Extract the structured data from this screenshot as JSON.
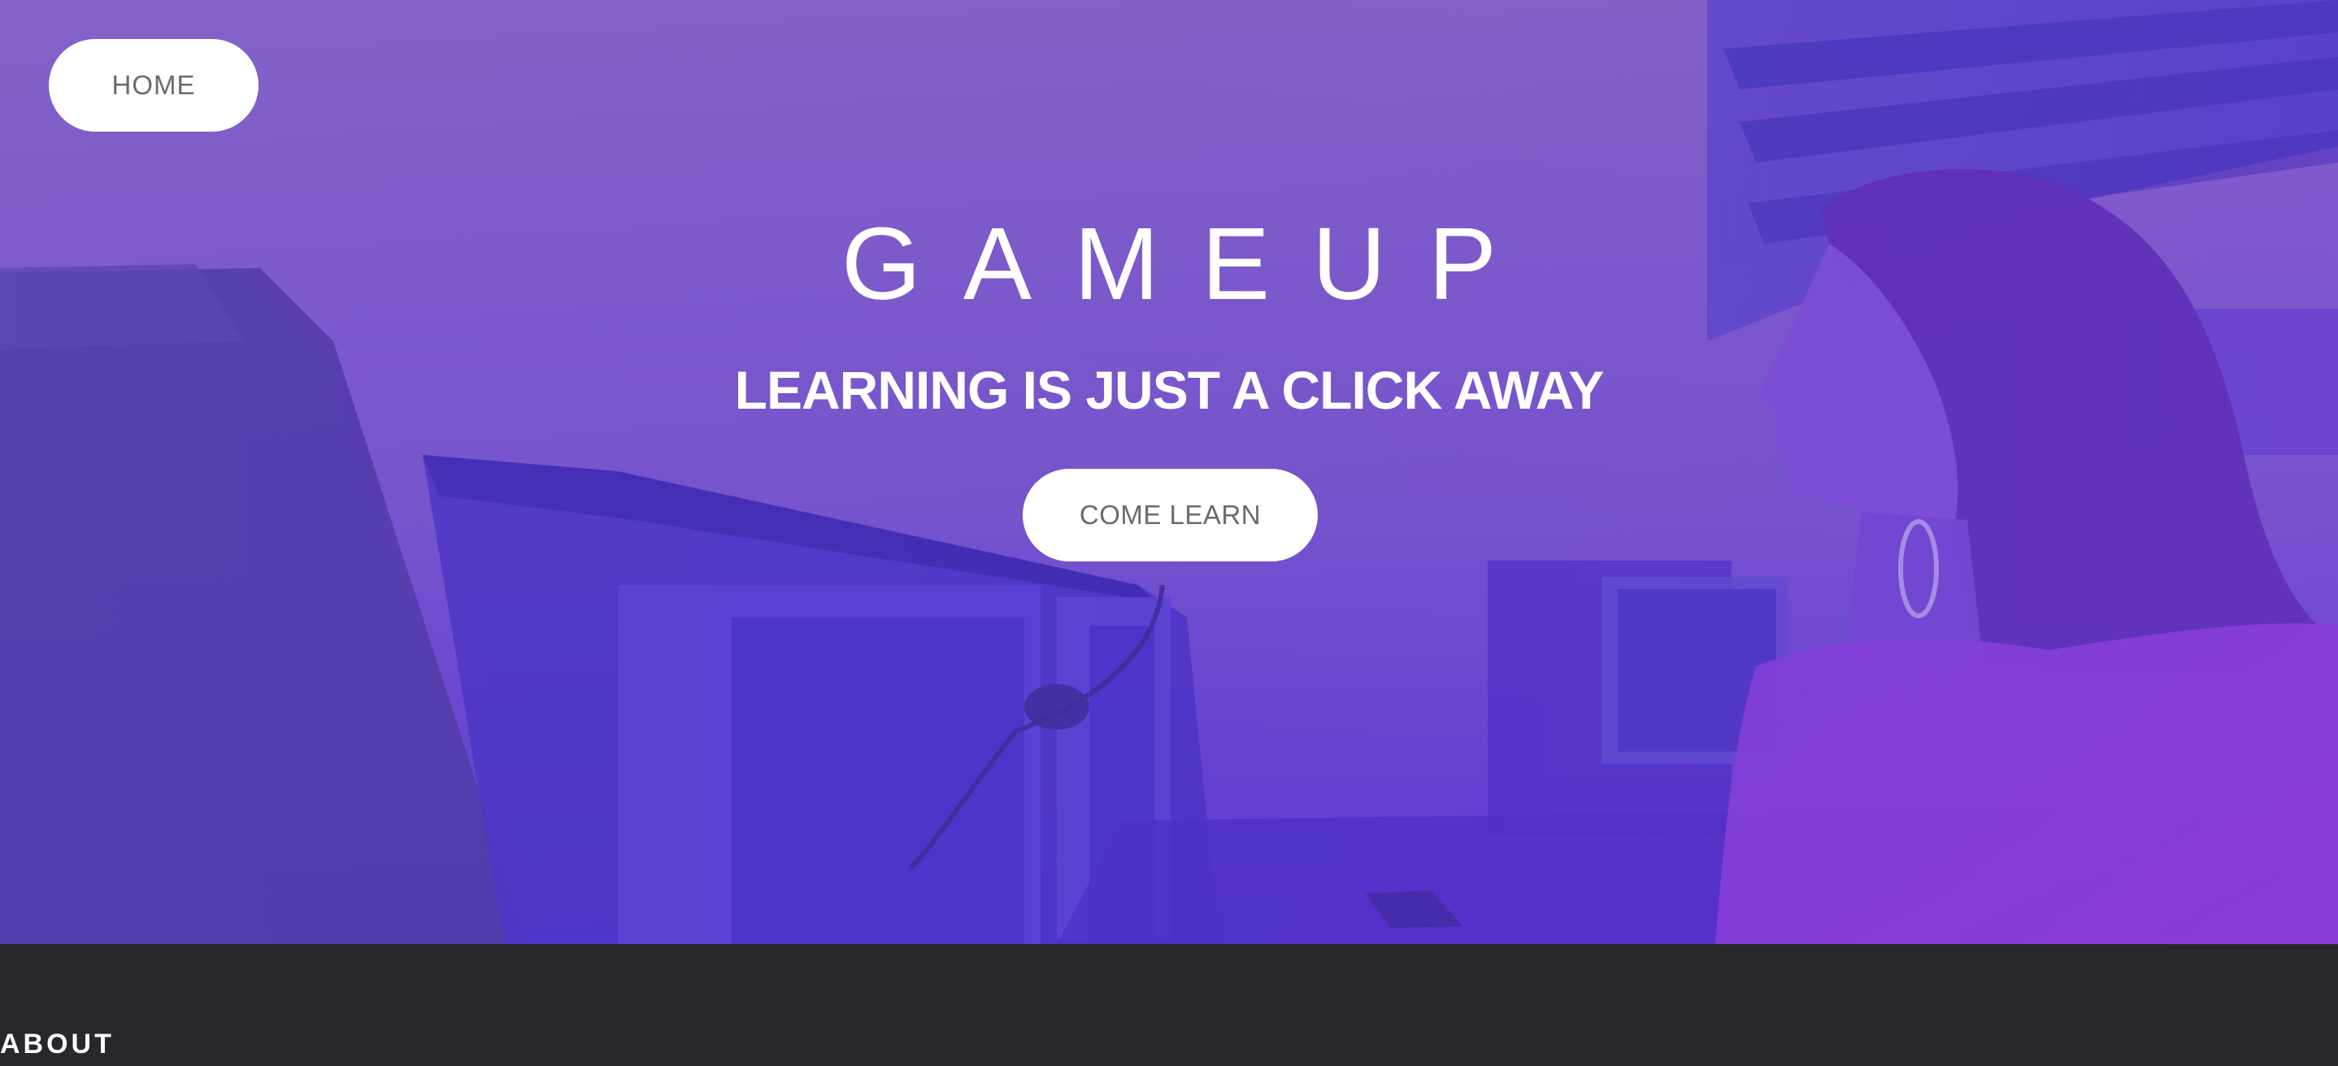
{
  "nav": {
    "home_label": "HOME"
  },
  "hero": {
    "title": "GAMEUP",
    "tagline": "LEARNING IS JUST A CLICK AWAY",
    "cta_label": "COME LEARN"
  },
  "about": {
    "heading": "ABOUT"
  },
  "colors": {
    "hero_overlay_top": "#8a63c7",
    "hero_overlay_bottom": "#5a33d6",
    "button_bg": "#ffffff",
    "button_text": "#6b6b6b",
    "section_bg": "#26282b"
  },
  "icons": {
    "hero_image": "person-at-computer-lab-photo"
  }
}
